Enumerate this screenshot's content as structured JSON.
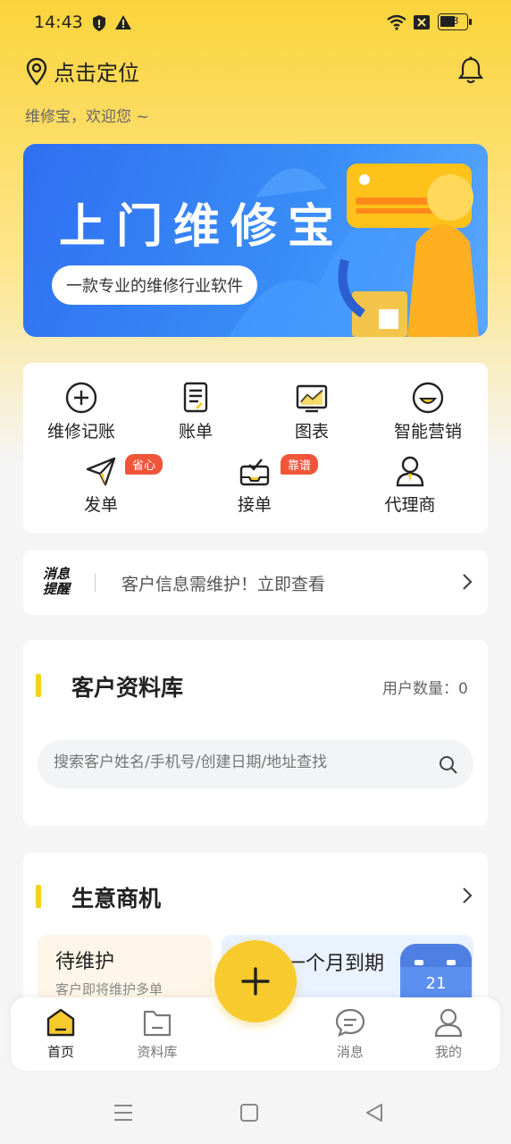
{
  "status_bar": {
    "time": "14:43",
    "battery": "53"
  },
  "header": {
    "location_label": "点击定位",
    "welcome": "维修宝，欢迎您 ~"
  },
  "banner": {
    "title": "上门维修宝",
    "subtitle": "一款专业的维修行业软件"
  },
  "quick_actions": {
    "row1": [
      {
        "label": "维修记账",
        "icon": "plus-circle-icon"
      },
      {
        "label": "账单",
        "icon": "document-icon"
      },
      {
        "label": "图表",
        "icon": "chart-icon"
      },
      {
        "label": "智能营销",
        "icon": "smile-icon"
      }
    ],
    "row2": [
      {
        "label": "发单",
        "icon": "send-icon",
        "tag": "省心"
      },
      {
        "label": "接单",
        "icon": "inbox-check-icon",
        "tag": "靠谱"
      },
      {
        "label": "代理商",
        "icon": "person-icon"
      }
    ]
  },
  "notice": {
    "badge": "消息提醒",
    "text": "客户信息需维护！立即查看"
  },
  "customer_library": {
    "title": "客户资料库",
    "count_label": "用户数量：0",
    "search_placeholder": "搜索客户姓名/手机号/创建日期/地址查找"
  },
  "business": {
    "title": "生意商机",
    "card1_title": "待维护",
    "card1_sub": "客户即将维护多单",
    "card2_title": "一个月到期",
    "calendar_day": "21"
  },
  "bottom_nav": [
    {
      "label": "首页",
      "active": true
    },
    {
      "label": "资料库"
    },
    {
      "label": "消息"
    },
    {
      "label": "我的"
    }
  ],
  "colors": {
    "accent": "#f7cb2d",
    "tag": "#f0553a",
    "banner": "#2f6ff2"
  }
}
